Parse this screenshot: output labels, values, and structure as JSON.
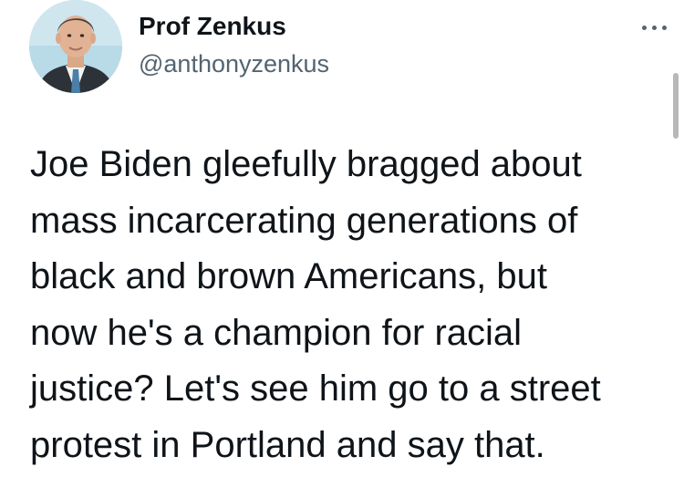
{
  "tweet": {
    "author": {
      "display_name": "Prof Zenkus",
      "handle": "@anthonyzenkus",
      "avatar_icon": "profile-photo"
    },
    "more_icon": "more-horizontal-icon",
    "text_lines": [
      "Joe Biden gleefully bragged about",
      "mass incarcerating generations of",
      "black and brown Americans, but",
      "now he's a champion for racial",
      "justice? Let's see him go to a street",
      "protest in Portland and say that."
    ]
  },
  "colors": {
    "text": "#0f1419",
    "secondary": "#536471",
    "avatar_bg": "#b9dbe8",
    "scrollbar": "#b8b8b8"
  }
}
